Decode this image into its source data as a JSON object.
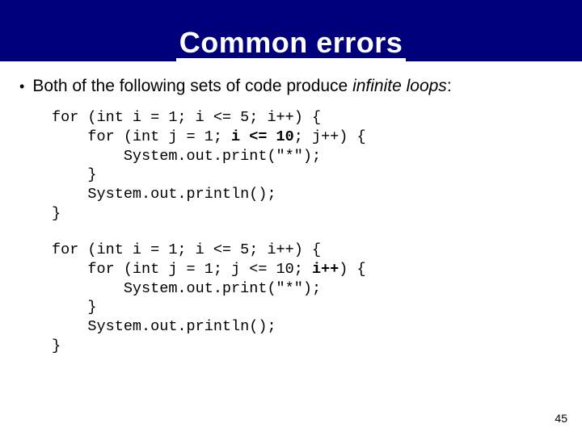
{
  "title": "Common errors",
  "bullet": {
    "prefix": "Both of the following sets of code produce ",
    "italic": "infinite loops",
    "suffix": ":"
  },
  "code1": {
    "l1a": "for (int i = 1; i <= 5; i++) {",
    "l2a": "    for (int j = 1; ",
    "l2b": "i <= 10",
    "l2c": "; j++) {",
    "l3": "        System.out.print(\"*\");",
    "l4": "    }",
    "l5": "    System.out.println();",
    "l6": "}"
  },
  "code2": {
    "l1a": "for (int i = 1; i <= 5; i++) {",
    "l2a": "    for (int j = 1; j <= 10; ",
    "l2b": "i++",
    "l2c": ") {",
    "l3": "        System.out.print(\"*\");",
    "l4": "    }",
    "l5": "    System.out.println();",
    "l6": "}"
  },
  "page_number": "45"
}
